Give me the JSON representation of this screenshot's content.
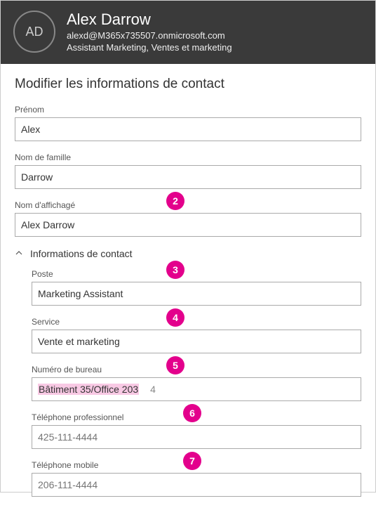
{
  "header": {
    "initials": "AD",
    "displayName": "Alex Darrow",
    "email": "alexd@M365x735507.onmicrosoft.com",
    "role": "Assistant Marketing, Ventes et marketing"
  },
  "form": {
    "title": "Modifier les informations de contact",
    "fields": {
      "firstName": {
        "label": "Prénom",
        "value": "Alex"
      },
      "lastName": {
        "label": "Nom de famille",
        "value": "Darrow"
      },
      "displayName": {
        "label": "Nom d'affichagé",
        "value": "Alex Darrow",
        "badge": "2"
      }
    },
    "contactSection": {
      "title": "Informations de contact",
      "fields": {
        "jobTitle": {
          "label": "Poste",
          "value": "Marketing Assistant",
          "badge": "3"
        },
        "department": {
          "label": "Service",
          "value": "Vente et marketing",
          "badge": "4"
        },
        "office": {
          "label": "Numéro de bureau",
          "value": "Bâtiment 35/Office 203",
          "badge": "5",
          "trailing": "4",
          "highlighted": true
        },
        "workPhone": {
          "label": "Téléphone professionnel",
          "placeholder": "425-111-4444",
          "badge": "6"
        },
        "mobilePhone": {
          "label": "Téléphone mobile",
          "placeholder": "206-111-4444",
          "badge": "7"
        }
      }
    }
  }
}
